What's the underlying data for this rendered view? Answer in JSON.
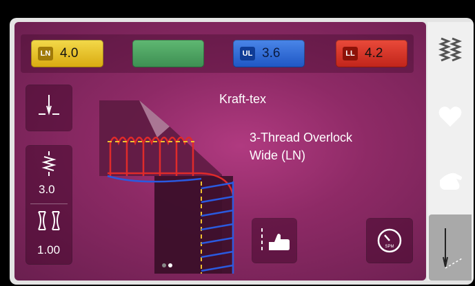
{
  "top_buttons": [
    {
      "code": "LN",
      "value": "4.0",
      "color": "#e9c22e"
    },
    {
      "code": "",
      "value": "",
      "color": "#4fa564"
    },
    {
      "code": "UL",
      "value": "3.6",
      "color": "#2f6fdc"
    },
    {
      "code": "LL",
      "value": "4.2",
      "color": "#d8342a"
    }
  ],
  "fabric": "Kraft-tex",
  "stitch_name_line1": "3-Thread Overlock",
  "stitch_name_line2": "Wide (LN)",
  "stitch_length": "3.0",
  "differential_feed": "1.00",
  "page_indicator": {
    "pages": 2,
    "active": 1
  },
  "side_tabs": [
    {
      "icon": "stitch-selection-icon",
      "active": false
    },
    {
      "icon": "heart-icon",
      "active": false
    },
    {
      "icon": "hand-icon",
      "active": false
    },
    {
      "icon": "needle-icon",
      "active": true
    }
  ],
  "bottom_buttons": [
    {
      "icon": "needle-position-hand-icon"
    },
    {
      "icon": "speed-gauge-icon",
      "text": "SPM"
    }
  ],
  "colors": {
    "background": "#8e2a66",
    "side_panel": "#f0f0f0",
    "side_active": "#a9a9a9"
  }
}
